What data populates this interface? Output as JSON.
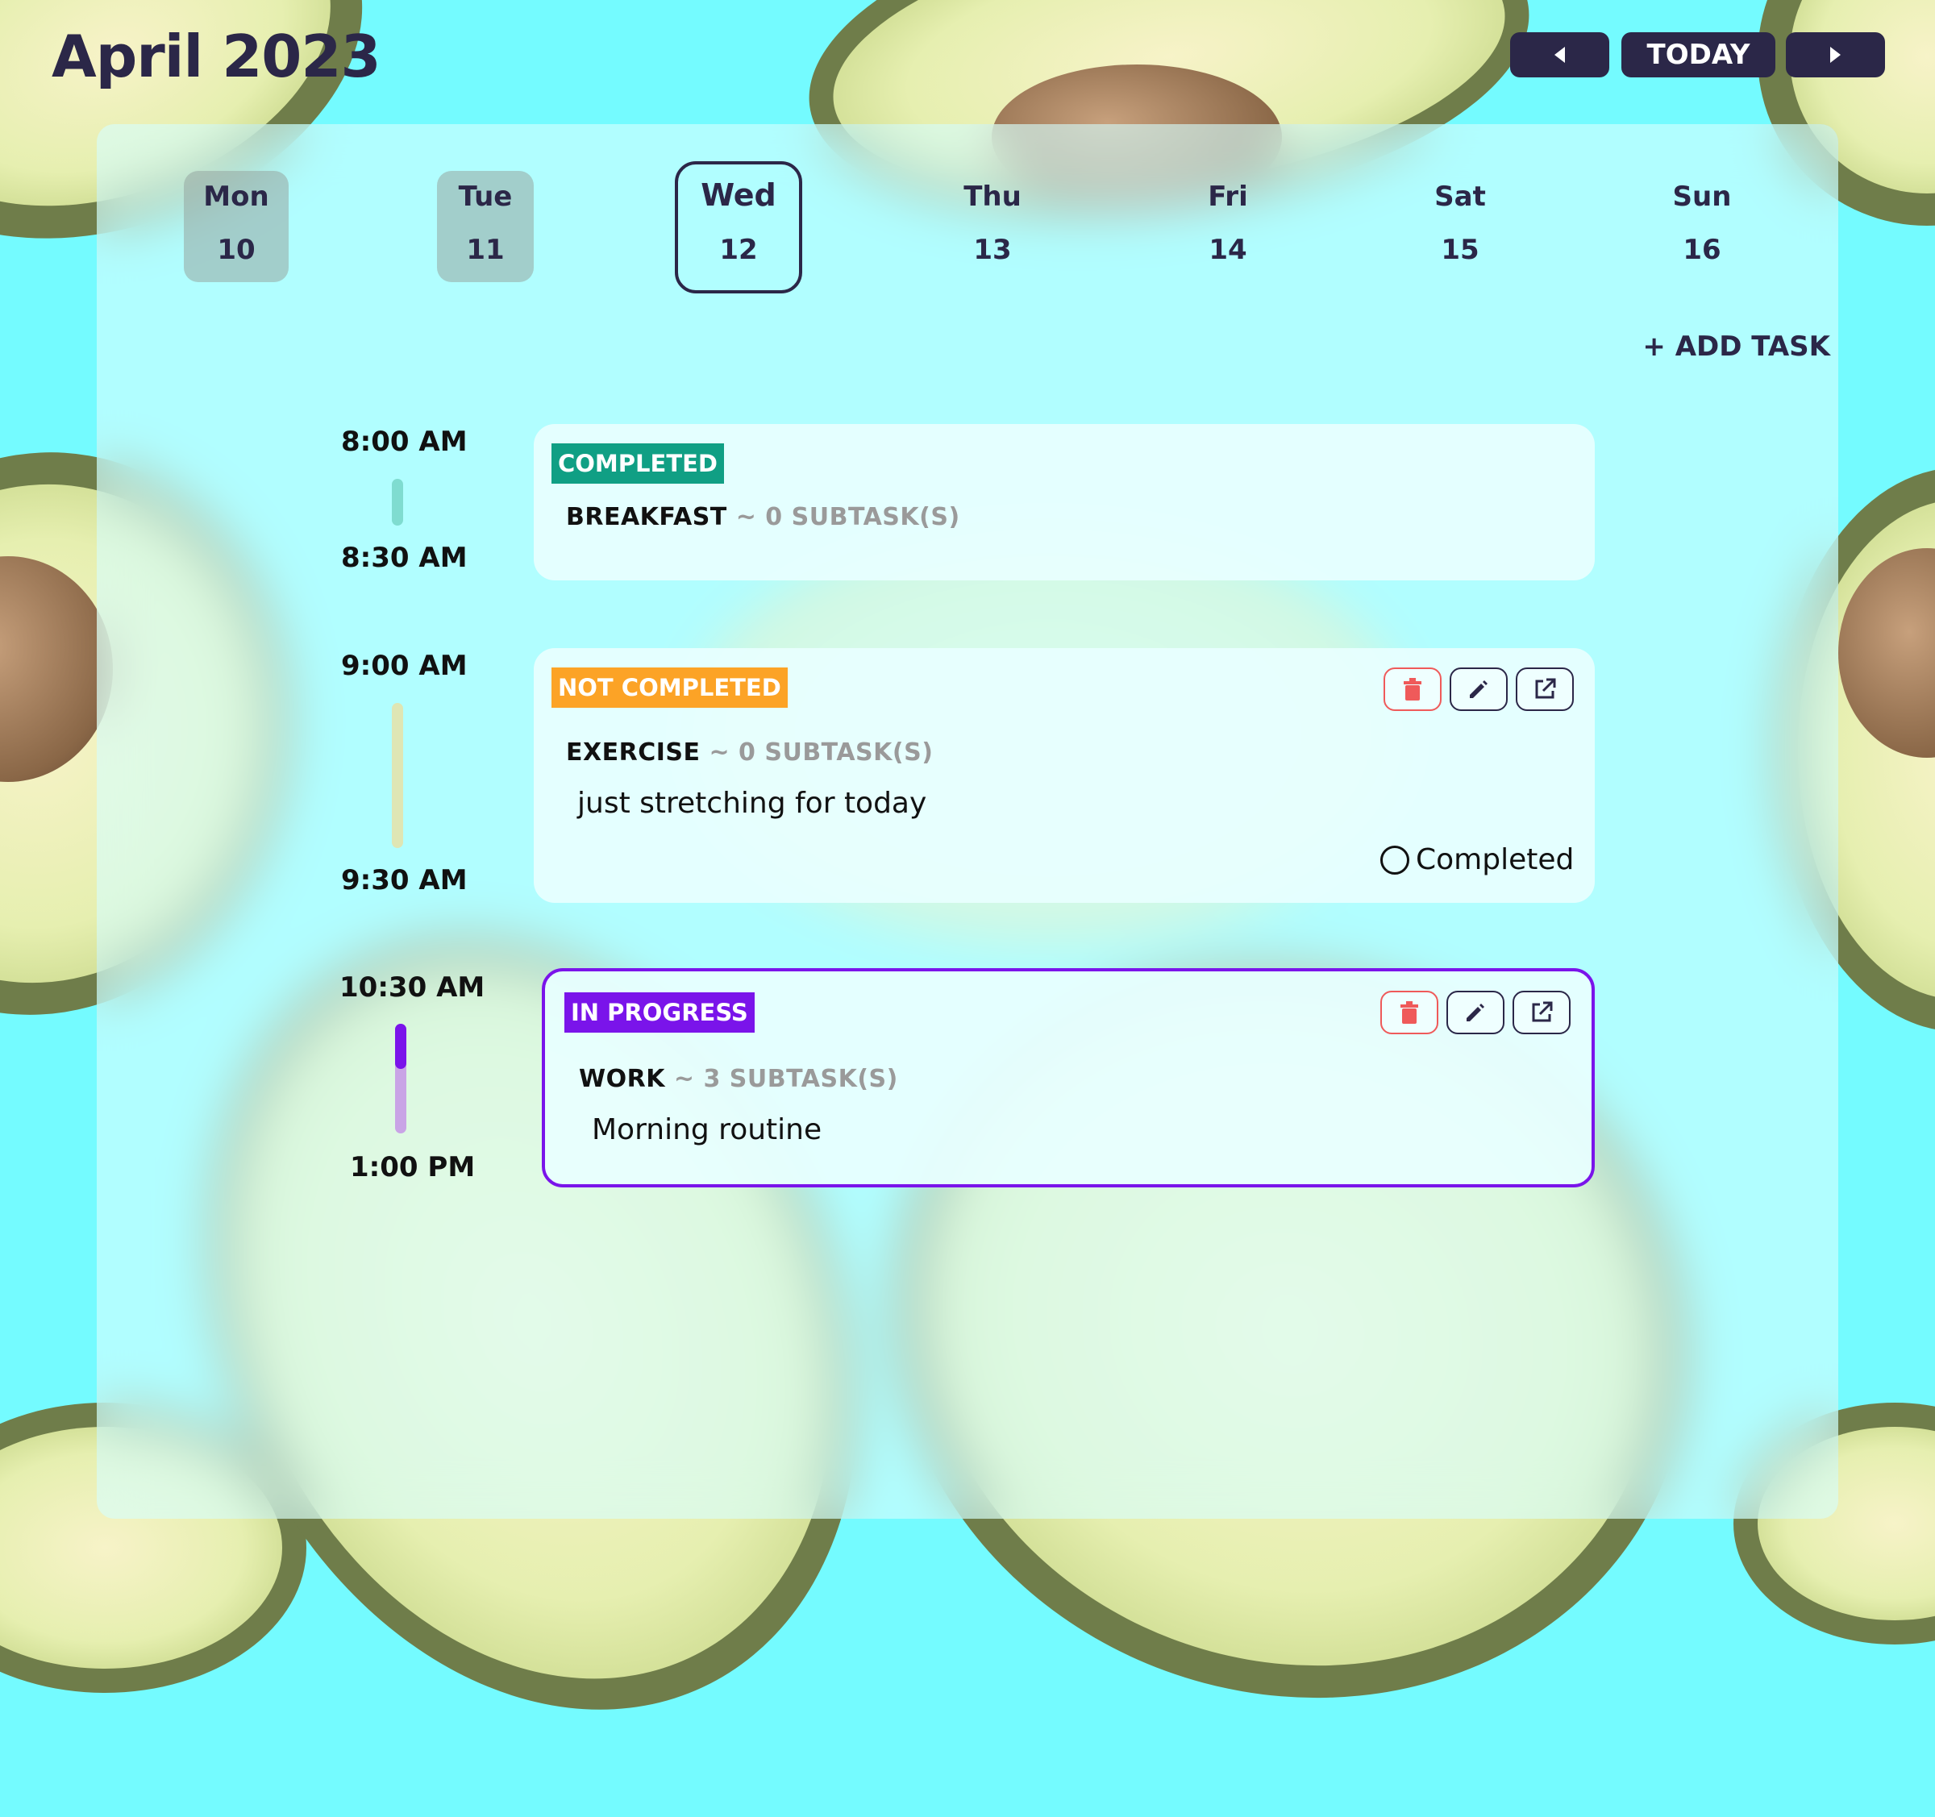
{
  "header": {
    "title": "April 2023",
    "today_label": "TODAY",
    "prev_icon": "caret-left-icon",
    "next_icon": "caret-right-icon"
  },
  "days": [
    {
      "name": "Mon",
      "num": "10"
    },
    {
      "name": "Tue",
      "num": "11"
    },
    {
      "name": "Wed",
      "num": "12"
    },
    {
      "name": "Thu",
      "num": "13"
    },
    {
      "name": "Fri",
      "num": "14"
    },
    {
      "name": "Sat",
      "num": "15"
    },
    {
      "name": "Sun",
      "num": "16"
    }
  ],
  "add_task_label": "+ ADD TASK",
  "tasks": [
    {
      "start": "8:00 AM",
      "end": "8:30 AM",
      "status": "COMPLETED",
      "status_color": "#109f84",
      "name": "BREAKFAST",
      "subtasks": "~ 0 SUBTASK(S)",
      "description": ""
    },
    {
      "start": "9:00 AM",
      "end": "9:30 AM",
      "status": "NOT COMPLETED",
      "status_color": "#fca326",
      "name": "EXERCISE",
      "subtasks": "~ 0 SUBTASK(S)",
      "description": "just stretching for today",
      "complete_label": "Completed"
    },
    {
      "start": "10:30 AM",
      "end": "1:00 PM",
      "status": "IN PROGRESS",
      "status_color": "#7a14ea",
      "name": "WORK",
      "subtasks": "~ 3 SUBTASK(S)",
      "description": "Morning routine"
    }
  ],
  "icons": {
    "delete": "trash-icon",
    "edit": "pencil-icon",
    "open": "external-link-icon"
  },
  "colors": {
    "background": "#74fbff",
    "text_dark": "#2b2748",
    "delete_red": "#ef5a5a"
  }
}
